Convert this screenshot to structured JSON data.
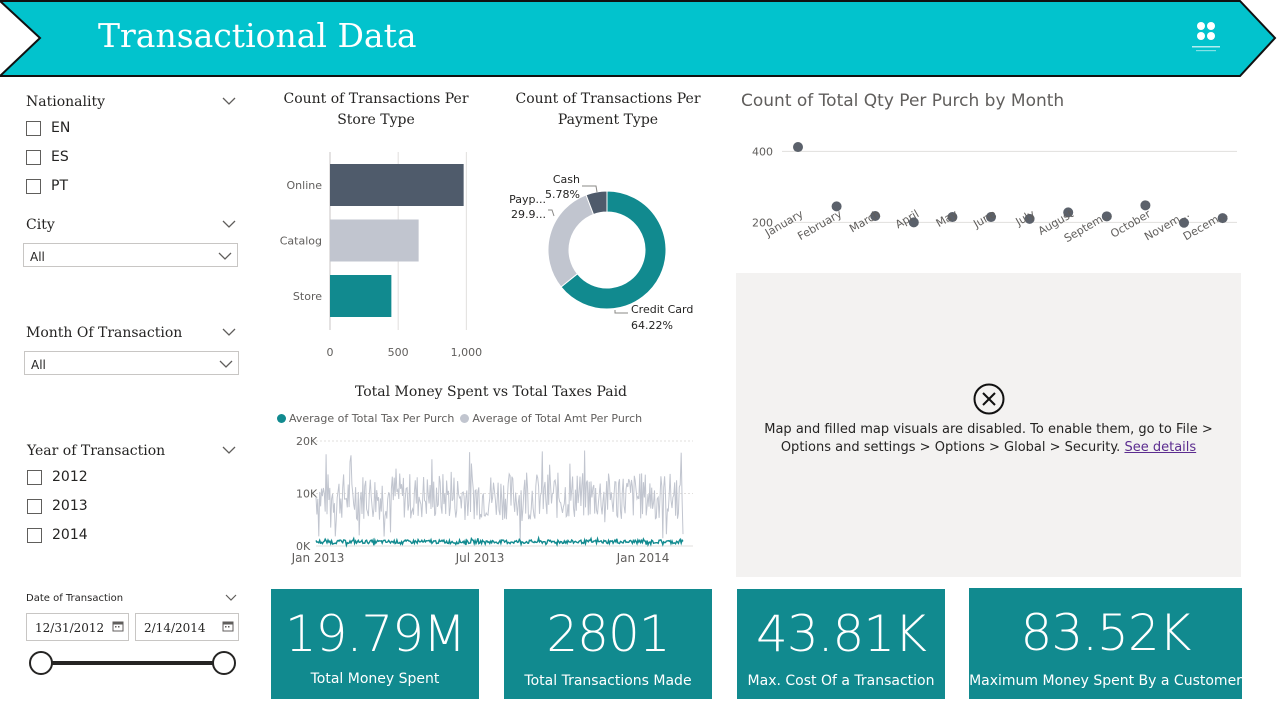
{
  "header": {
    "title": "Transactional Data",
    "logo": "grid-logo-icon"
  },
  "slicers": {
    "nationality": {
      "title": "Nationality",
      "options": [
        "EN",
        "ES",
        "PT"
      ]
    },
    "city": {
      "title": "City",
      "selected": "All"
    },
    "month": {
      "title": "Month Of Transaction",
      "selected": "All"
    },
    "year": {
      "title": "Year of Transaction",
      "options": [
        "2012",
        "2013",
        "2014"
      ]
    },
    "date": {
      "title": "Date of Transaction",
      "start": "12/31/2012",
      "end": "2/14/2014"
    }
  },
  "charts": {
    "store_type": {
      "title_line1": "Count of Transactions Per",
      "title_line2": "Store Type"
    },
    "payment_type": {
      "title_line1": "Count of Transactions Per",
      "title_line2": "Payment Type"
    },
    "qty_month": {
      "title": "Count of Total Qty Per Purch by Month"
    },
    "money_tax": {
      "title": "Total Money Spent vs Total Taxes Paid"
    }
  },
  "chart_data": [
    {
      "type": "bar",
      "orientation": "horizontal",
      "title": "Count of Transactions Per Store Type",
      "categories": [
        "Online",
        "Catalog",
        "Store"
      ],
      "values": [
        980,
        650,
        450
      ],
      "x_ticks": [
        "0",
        "500",
        "1,000"
      ],
      "xlim": [
        0,
        1100
      ],
      "colors": [
        "#4f5b6b",
        "#c1c5cf",
        "#118a8f"
      ]
    },
    {
      "type": "pie",
      "subtype": "donut",
      "title": "Count of Transactions Per Payment Type",
      "slices": [
        {
          "name": "Credit Card",
          "value": 64.22,
          "label": "64.22%",
          "color": "#118a8f"
        },
        {
          "name": "Payp...",
          "value": 30.0,
          "label": "29.9...",
          "color": "#c1c5cf"
        },
        {
          "name": "Cash",
          "value": 5.78,
          "label": "5.78%",
          "color": "#4f5b6b"
        }
      ]
    },
    {
      "type": "scatter",
      "title": "Count of Total Qty Per Purch by Month",
      "categories": [
        "January",
        "February",
        "March",
        "April",
        "May",
        "June",
        "July",
        "August",
        "Septem...",
        "October",
        "Novem...",
        "Decem..."
      ],
      "values": [
        412,
        245,
        218,
        200,
        215,
        215,
        210,
        228,
        217,
        248,
        199,
        212
      ],
      "y_ticks": [
        "200",
        "400"
      ],
      "ylim": [
        80,
        460
      ],
      "color": "#5b616b",
      "grid": true
    },
    {
      "type": "line",
      "title": "Total Money Spent vs Total Taxes Paid",
      "series": [
        {
          "name": "Average of Total Tax Per Purch",
          "color": "#118a8f",
          "level": 800,
          "spread": 500
        },
        {
          "name": "Average of Total Amt Per Purch",
          "color": "#c1c5cf",
          "level": 9500,
          "spread": 6500
        }
      ],
      "x_ticks": [
        "Jan 2013",
        "Jul 2013",
        "Jan 2014"
      ],
      "y_ticks": [
        "0K",
        "10K",
        "20K"
      ],
      "ylim": [
        0,
        20000
      ],
      "legend": "top"
    }
  ],
  "map": {
    "message_line1": "Map and filled map visuals are disabled. To enable them, go to File >",
    "message_line2": "Options and settings > Options > Global > Security.",
    "link": "See details",
    "icon": "close-circle-icon"
  },
  "kpis": [
    {
      "value": "19.79M",
      "label": "Total Money Spent"
    },
    {
      "value": "2801",
      "label": "Total Transactions Made"
    },
    {
      "value": "43.81K",
      "label": "Max. Cost Of a Transaction"
    },
    {
      "value": "83.52K",
      "label": "Maximum Money Spent By a Customer"
    }
  ],
  "colors": {
    "banner": "#02c3cd",
    "teal": "#118a8f",
    "dark_slate": "#4f5b6b",
    "light_gray": "#c1c5cf"
  }
}
